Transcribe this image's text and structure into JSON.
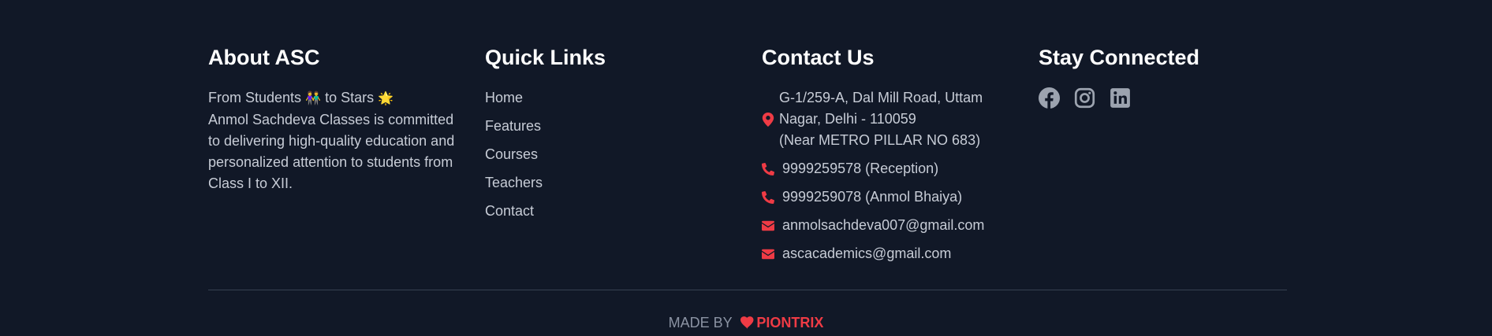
{
  "about": {
    "title": "About ASC",
    "tagline_start": "From Students",
    "tagline_emoji1": "👫",
    "tagline_mid": "to Stars",
    "tagline_emoji2": "🌟",
    "description": "Anmol Sachdeva Classes is committed to delivering high-quality education and personalized attention to students from Class I to XII."
  },
  "quick_links": {
    "title": "Quick Links",
    "items": [
      "Home",
      "Features",
      "Courses",
      "Teachers",
      "Contact"
    ]
  },
  "contact": {
    "title": "Contact Us",
    "address_line1": "G-1/259-A, Dal Mill Road, Uttam",
    "address_line2": "Nagar, Delhi - 110059",
    "address_line3": "(Near METRO PILLAR NO 683)",
    "phone1": "9999259578 (Reception)",
    "phone2": "9999259078 (Anmol Bhaiya)",
    "email1": "anmolsachdeva007@gmail.com",
    "email2": "ascacademics@gmail.com",
    "icon_color": "#ef3b45"
  },
  "social": {
    "title": "Stay Connected",
    "icons": [
      "facebook-icon",
      "instagram-icon",
      "linkedin-icon"
    ],
    "icon_color": "#9ca3af"
  },
  "footer": {
    "made_by_label": "MADE BY",
    "brand": "PIONTRIX",
    "heart_icon": "heart-icon",
    "brand_color": "#ef3b45"
  },
  "colors": {
    "background": "#111827",
    "heading": "#ffffff",
    "text": "#c7ccd6",
    "divider": "#374151"
  }
}
